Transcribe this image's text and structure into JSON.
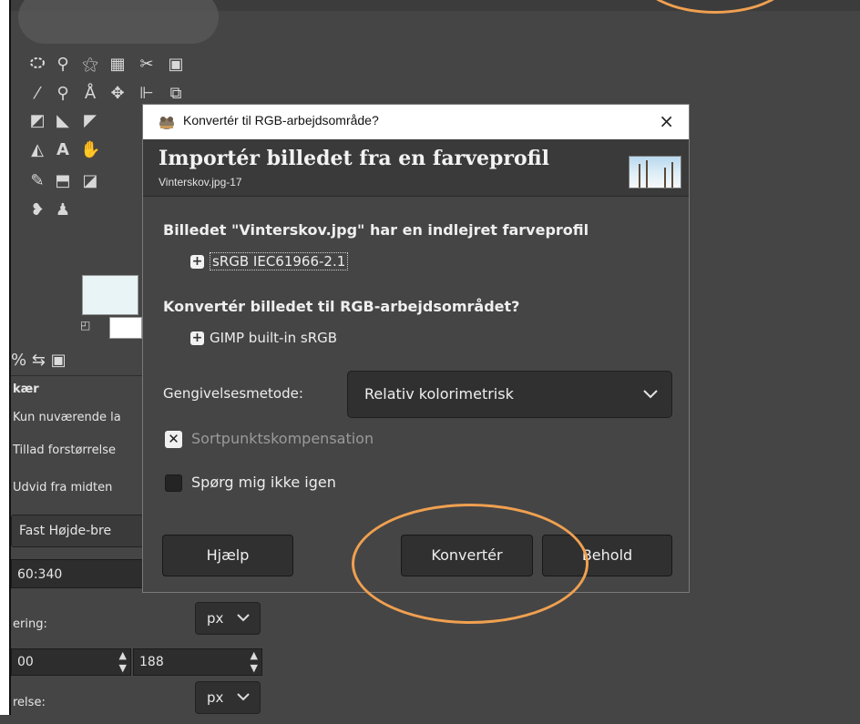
{
  "dialog": {
    "window_title": "Konvertér til RGB-arbejdsområde?",
    "close_glyph": "×",
    "header_title": "Importér billedet fra en farveprofil",
    "header_subtitle": "Vinterskov.jpg-17",
    "embedded_heading": "Billedet \"Vinterskov.jpg\" har en indlejret farveprofil",
    "embedded_profile": "sRGB IEC61966-2.1",
    "convert_heading": "Konvertér billedet til RGB-arbejdsområdet?",
    "target_profile": "GIMP built-in sRGB",
    "rendering_label": "Gengivelsesmetode:",
    "rendering_value": "Relativ kolorimetrisk",
    "blackpoint_label": "Sortpunktskompensation",
    "blackpoint_checked": true,
    "dont_ask_label": "Spørg mig ikke igen",
    "dont_ask_checked": false,
    "buttons": {
      "help": "Hjælp",
      "convert": "Konvertér",
      "keep": "Behold"
    }
  },
  "tool_options": {
    "section_title": "kær",
    "current_layer": "Kun nuværende la",
    "allow_enlarge": "Tillad forstørrelse",
    "expand_center": "Udvid fra midten",
    "fixed_mode": "Fast  Højde-bre",
    "ratio_value": "60:340",
    "position_label": "ering:",
    "unit_1": "px",
    "pos_x": "00",
    "pos_y": "188",
    "size_label": "relse:",
    "unit_2": "px"
  },
  "colors": {
    "annotation": "#f0a050",
    "foreground": "#e8f4f6",
    "background": "#ffffff"
  }
}
